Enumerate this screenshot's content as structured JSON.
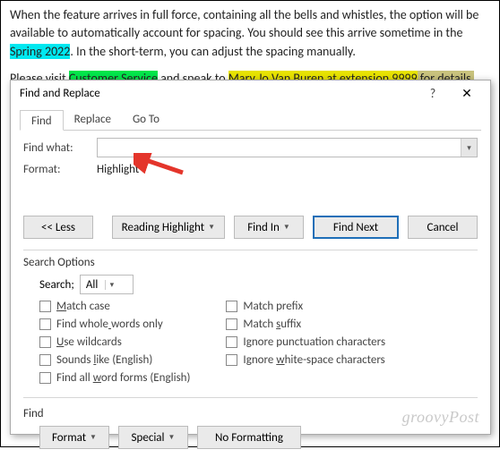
{
  "doc": {
    "p1_a": "When the feature arrives in full force, containing all the bells and whistles, the option will be available to automatically account for spacing. You should see this arrive sometime in the ",
    "p1_hl": "Spring 2022",
    "p1_b": ". In the short-term, you can adjust the spacing manually.",
    "p2_a": "Please visit ",
    "p2_hl1": "Customer Service",
    "p2_b": " and speak to ",
    "p2_hl2": "Mary Jo Van Buren at extension 9999",
    "p2_c": " for details."
  },
  "dialog": {
    "title": "Find and Replace",
    "help": "?",
    "close": "✕",
    "tabs": {
      "find": "Find",
      "replace": "Replace",
      "goto": "Go To"
    },
    "labels": {
      "find_what": "Find what:",
      "format": "Format:"
    },
    "format_value": "Highlight",
    "buttons": {
      "less": "<<  Less",
      "reading_highlight": "Reading Highlight",
      "find_in": "Find In",
      "find_next": "Find Next",
      "cancel": "Cancel",
      "format": "Format",
      "special": "Special",
      "no_formatting": "No Formatting"
    },
    "sections": {
      "search_options": "Search Options",
      "find": "Find"
    },
    "search_label": "Search;",
    "search_value": "All",
    "checks_left": [
      {
        "label": "Match case",
        "u": 0
      },
      {
        "label": "Find whole words only",
        "u": 10
      },
      {
        "label": "Use wildcards",
        "u": 0
      },
      {
        "label": "Sounds like (English)",
        "u": 7
      },
      {
        "label": "Find all word forms (English)",
        "u": 9
      }
    ],
    "checks_right": [
      {
        "label": "Match prefix",
        "u": -1
      },
      {
        "label": "Match suffix",
        "u": 6
      },
      {
        "label": "Ignore punctuation characters",
        "u": -1
      },
      {
        "label": "Ignore white-space characters",
        "u": 7
      }
    ]
  },
  "watermark": "groovyPost"
}
